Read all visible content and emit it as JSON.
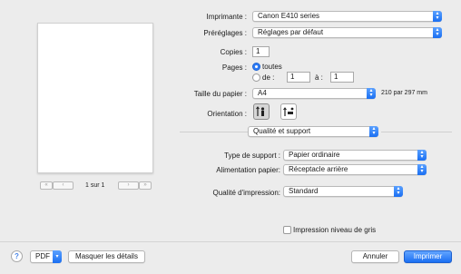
{
  "preview": {
    "page_indicator": "1 sur 1"
  },
  "printer": {
    "label": "Imprimante :",
    "value": "Canon E410 series"
  },
  "presets": {
    "label": "Préréglages :",
    "value": "Réglages par défaut"
  },
  "copies": {
    "label": "Copies :",
    "value": "1"
  },
  "pages": {
    "label": "Pages :",
    "all_label": "toutes",
    "from_label": "de :",
    "from_value": "1",
    "to_label": "à :",
    "to_value": "1"
  },
  "paper_size": {
    "label": "Taille du papier :",
    "value": "A4",
    "dimensions": "210 par 297 mm"
  },
  "orientation": {
    "label": "Orientation :"
  },
  "section": {
    "value": "Qualité et support"
  },
  "media_type": {
    "label": "Type de support :",
    "value": "Papier ordinaire"
  },
  "paper_source": {
    "label": "Alimentation papier:",
    "value": "Réceptacle arrière"
  },
  "print_quality": {
    "label": "Qualité d'impression:",
    "value": "Standard"
  },
  "grayscale": {
    "label": "Impression niveau de gris",
    "checked": false
  },
  "footer": {
    "help": "?",
    "pdf_label": "PDF",
    "details_label": "Masquer les détails",
    "cancel_label": "Annuler",
    "print_label": "Imprimer"
  },
  "colors": {
    "accent": "#1b6ff3"
  },
  "icons": [
    "prev-page-icon",
    "next-page-icon",
    "portrait-icon",
    "landscape-icon",
    "help-icon",
    "popup-arrows-icon"
  ]
}
